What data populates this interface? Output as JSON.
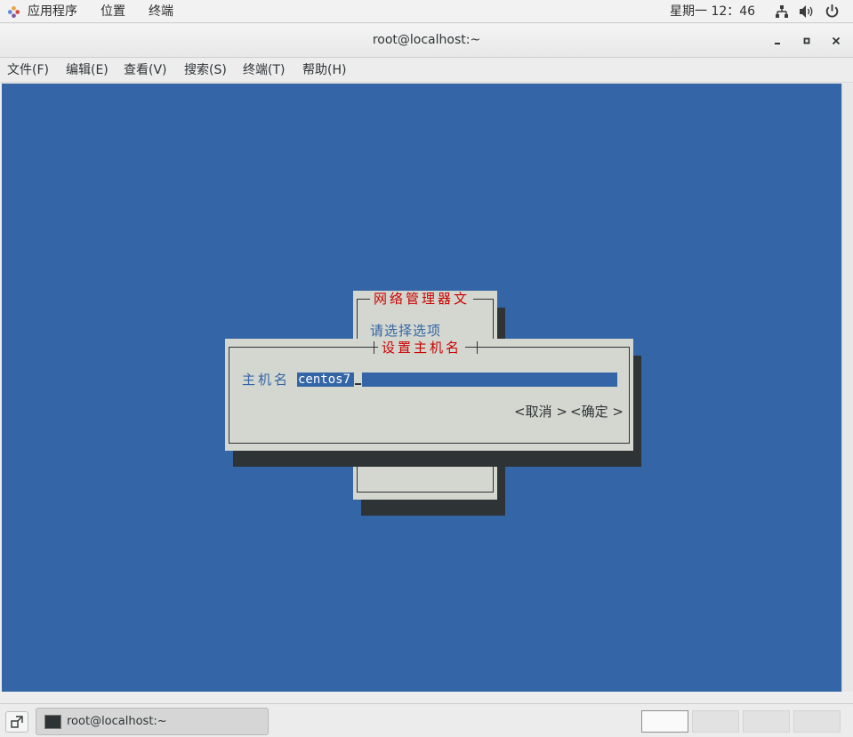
{
  "top_panel": {
    "apps_label": "应用程序",
    "places_label": "位置",
    "terminal_label": "终端",
    "clock": "星期一 12：46"
  },
  "window": {
    "title": "root@localhost:~"
  },
  "menu": {
    "items": [
      "文件(F)",
      "编辑(E)",
      "查看(V)",
      "搜索(S)",
      "终端(T)",
      "帮助(H)"
    ]
  },
  "tui": {
    "back_dialog_title": "网络管理器文",
    "back_dialog_prompt": "请选择选项",
    "front_dialog_title": "设置主机名",
    "hostname_label": "主机名",
    "hostname_value": "centos7",
    "cancel_button": "<取消 >",
    "ok_button": "<确定 >"
  },
  "taskbar": {
    "task_label": "root@localhost:~",
    "workspaces": 4,
    "active_workspace": 1
  },
  "colors": {
    "terminal_bg": "#3465a6",
    "dialog_bg": "#d3d7cf",
    "dialog_title": "#cc0000",
    "shadow": "#2e3436"
  }
}
